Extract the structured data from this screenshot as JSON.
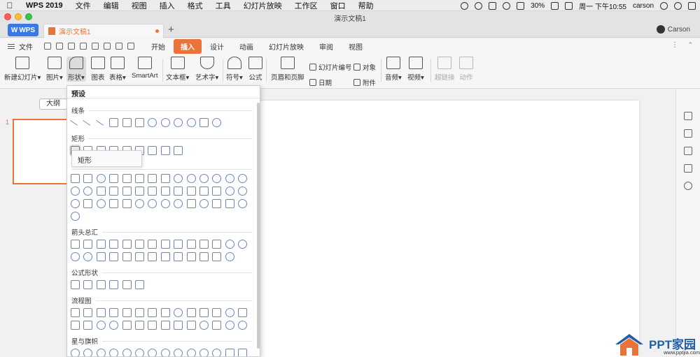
{
  "menubar": {
    "app": "WPS 2019",
    "items": [
      "文件",
      "编辑",
      "视图",
      "插入",
      "格式",
      "工具",
      "幻灯片放映",
      "工作区",
      "窗口",
      "帮助"
    ],
    "battery": "30%",
    "clock": "周一 下午10:55",
    "user": "carson"
  },
  "window": {
    "title": "演示文稿1"
  },
  "tabs": {
    "home": "WPS",
    "doc": "演示文稿1",
    "add": "+",
    "user": "Carson"
  },
  "ribbon_tabs": {
    "file": "文件",
    "items": [
      "开始",
      "插入",
      "设计",
      "动画",
      "幻灯片放映",
      "审阅",
      "视图"
    ],
    "active": "插入",
    "more": "⋮",
    "caret": "⌃"
  },
  "toolbar": {
    "new_slide": "新建幻灯片",
    "picture": "图片",
    "shape": "形状",
    "chart": "图表",
    "table": "表格",
    "smartart": "SmartArt",
    "textbox": "文本框",
    "wordart": "艺术字",
    "symbol": "符号",
    "formula": "公式",
    "header_footer": "页眉和页脚",
    "slide_number": "幻灯片编号",
    "object": "对象",
    "date": "日期",
    "attachment": "附件",
    "audio": "音频",
    "video": "视频",
    "hyperlink": "超链接",
    "action": "动作",
    "dropdown_arrow": "▾"
  },
  "left_panel": {
    "outline": "大纲",
    "slide_number": "1"
  },
  "shapes_panel": {
    "preset": "预设",
    "sections": {
      "lines": "线条",
      "rectangles": "矩形",
      "arrows": "箭头总汇",
      "formula": "公式形状",
      "flowchart": "流程图",
      "stars": "星与旗帜"
    },
    "tooltip": "矩形"
  },
  "watermark": {
    "title": "PPT家园",
    "url": "www.pptjia.com"
  },
  "colors": {
    "accent": "#e9743a",
    "wps_blue": "#3b78e7",
    "shape_stroke": "#6b84c4"
  }
}
